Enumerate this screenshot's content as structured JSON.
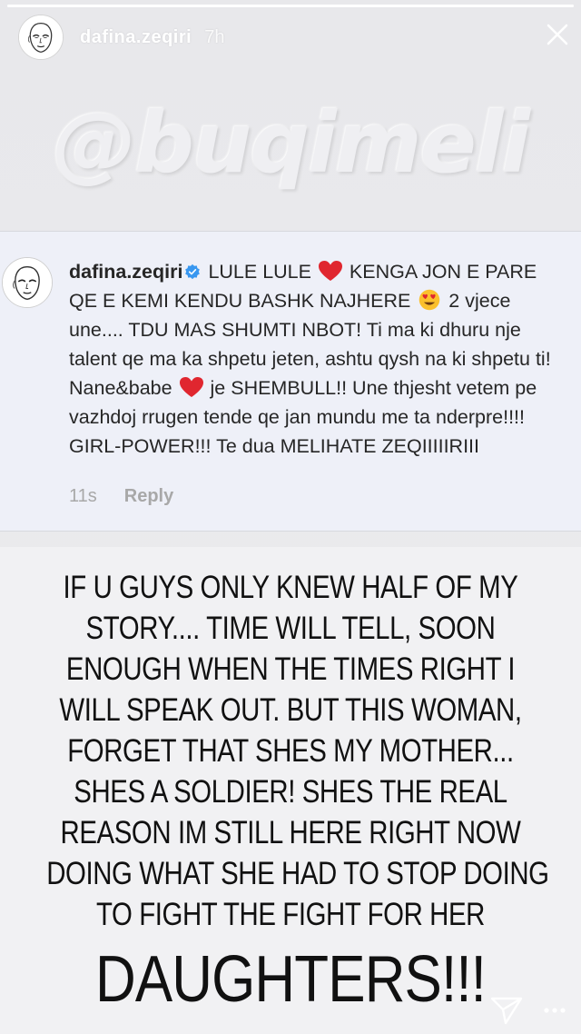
{
  "header": {
    "username": "dafina.zeqiri",
    "time": "7h",
    "progress": 1.0
  },
  "mention": "@buqimeli",
  "comment": {
    "username": "dafina.zeqiri",
    "verified": true,
    "text_parts": [
      "LULE LULE ",
      " KENGA JON E PARE QE E KEMI KENDU BASHK NAJHERE ",
      " 2 vjece une.... TDU MAS SHUMTI NBOT! Ti ma ki dhuru nje talent qe ma ka shpetu jeten, ashtu qysh na ki shpetu ti! Nane&babe ",
      " je SHEMBULL!! Une thjesht vetem pe vazhdoj rrugen tende qe jan mundu me ta nderpre!!!! GIRL-POWER!!! Te dua MELIHATE ZEQIIIIIRIII"
    ],
    "emojis": [
      "red-heart",
      "heart-eyes",
      "red-heart"
    ],
    "time": "11s",
    "reply_label": "Reply"
  },
  "caption": {
    "lines": [
      "IF U GUYS ONLY KNEW HALF OF MY",
      "STORY.... TIME WILL TELL, SOON",
      "ENOUGH WHEN THE TIMES RIGHT I",
      "WILL SPEAK OUT. BUT THIS WOMAN,",
      "FORGET THAT SHES MY MOTHER...",
      "SHES A SOLDIER! SHES THE REAL",
      "REASON IM STILL HERE RIGHT NOW",
      "DOING WHAT SHE HAD TO STOP DOING",
      "TO FIGHT THE FIGHT FOR HER"
    ],
    "big": "DAUGHTERS!!!"
  },
  "icons": {
    "close": "close-icon",
    "send": "send-icon",
    "more": "more-icon"
  },
  "colors": {
    "verified": "#3897f0",
    "heart": "#e0262f",
    "comment_bg": "#eef0f8"
  }
}
